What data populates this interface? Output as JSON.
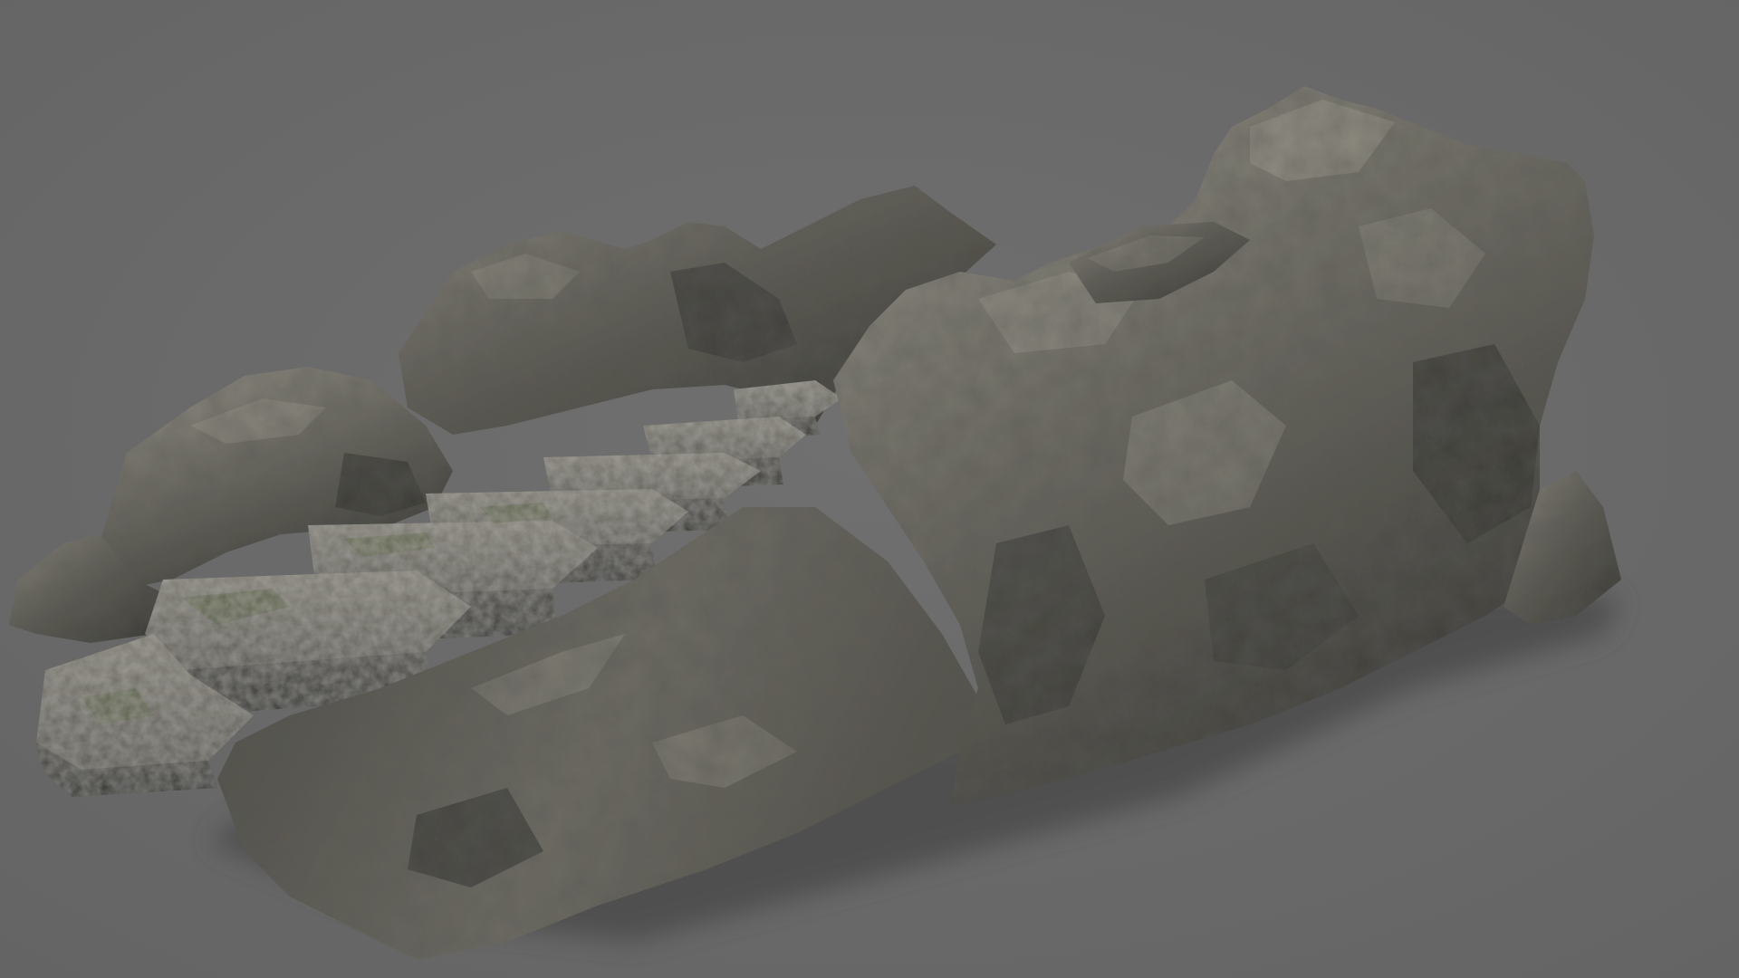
{
  "viewport": {
    "background_color": "#6a6a6a",
    "shadow_color": "#4a4a4a"
  },
  "model": {
    "subject": "rock-stairs-3d-model",
    "parts": [
      "stair-steps",
      "left-rock-wall",
      "back-rock-wall",
      "large-right-boulder",
      "front-rock-base",
      "ground-shadow"
    ],
    "colors": {
      "rock_light": "#8d8a80",
      "rock_mid": "#5e5c55",
      "rock_dark": "#2f2f2c",
      "step_top": "#77756c",
      "moss": "#4f5a36"
    }
  }
}
